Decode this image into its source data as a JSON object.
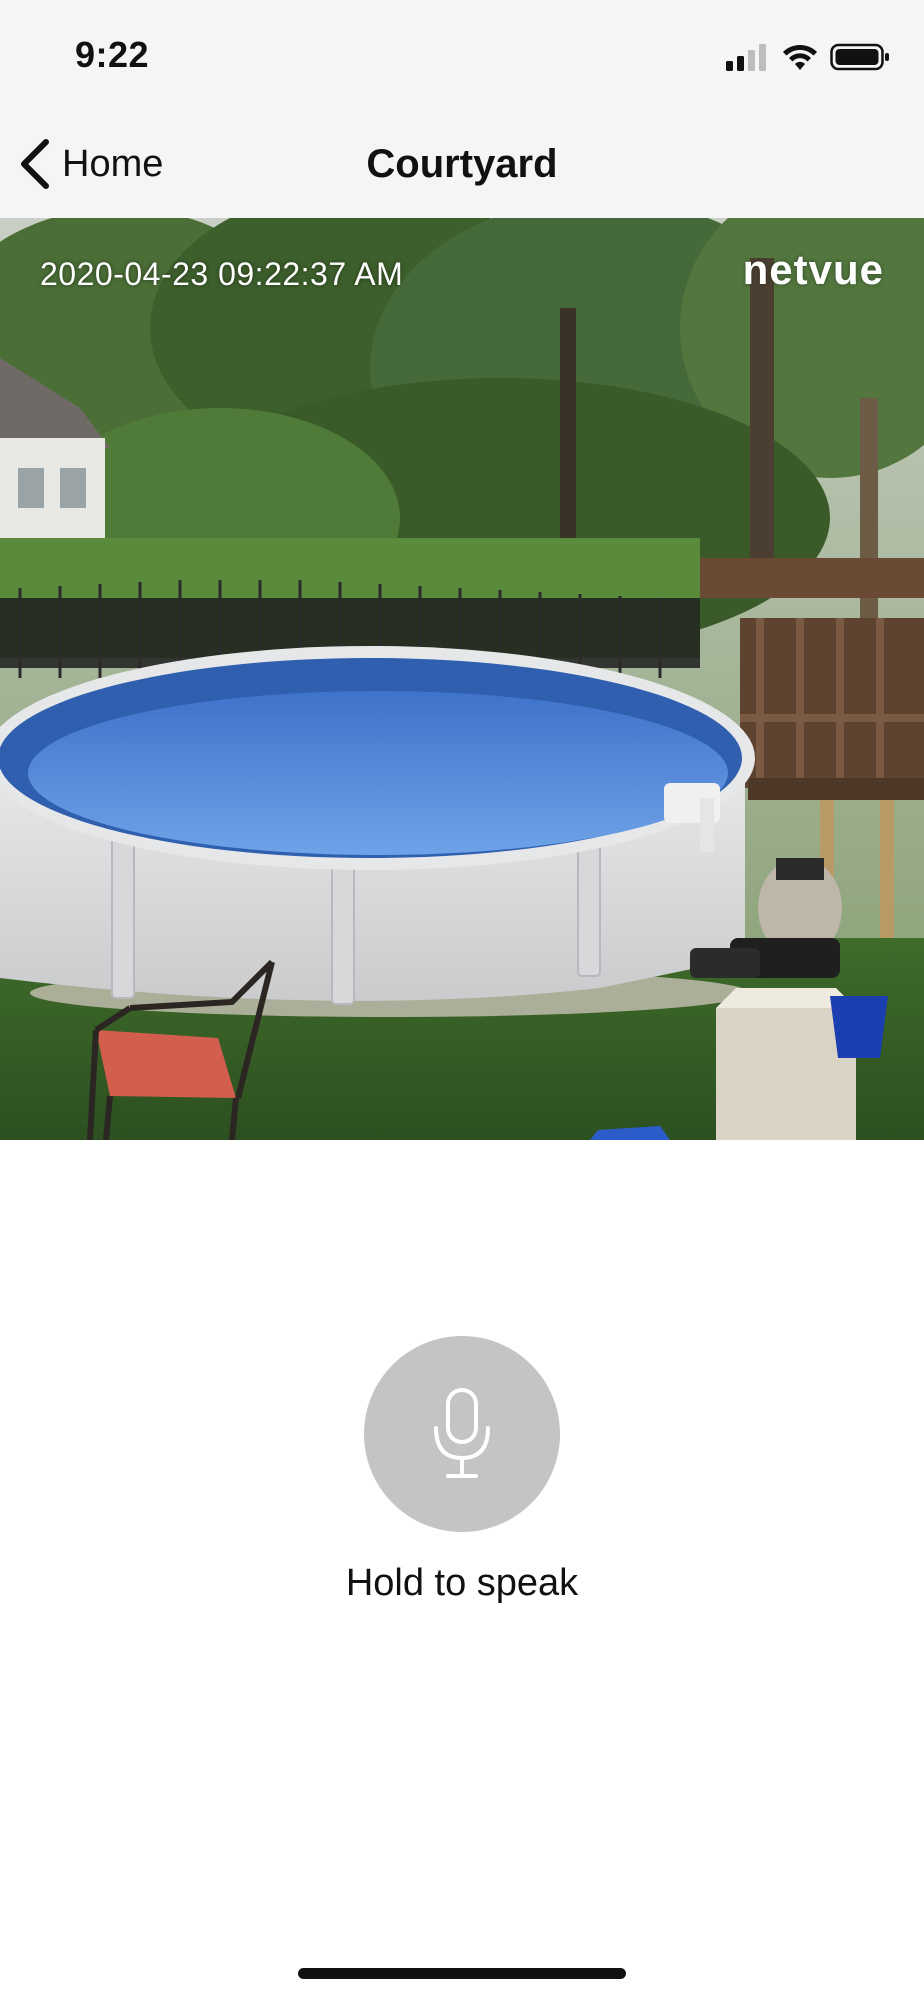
{
  "status_bar": {
    "time": "9:22",
    "icons": [
      "signal-icon",
      "wifi-icon",
      "battery-icon"
    ]
  },
  "nav": {
    "back_label": "Home",
    "title": "Courtyard"
  },
  "camera": {
    "timestamp": "2020-04-23 09:22:37 AM",
    "brand": "netvue"
  },
  "talk": {
    "icon": "microphone-icon",
    "label": "Hold to speak"
  },
  "colors": {
    "bar_bg": "#f5f5f5",
    "mic_bg": "#c4c4c4",
    "text": "#111111"
  }
}
